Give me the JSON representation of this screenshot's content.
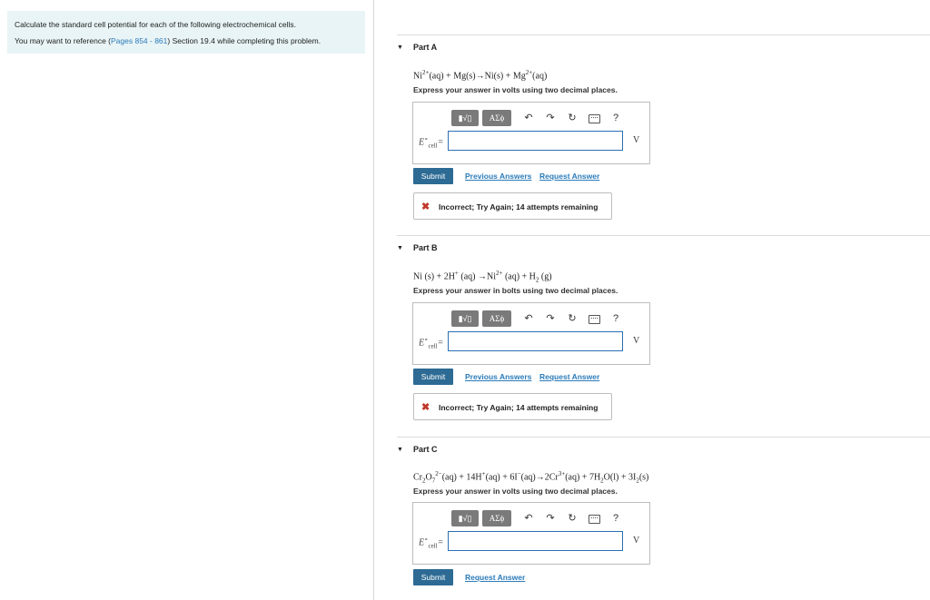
{
  "instructions": {
    "line1": "Calculate the standard cell potential for each of the following electrochemical cells.",
    "line2_prefix": "You may want to reference (",
    "line2_link": "Pages 854 - 861",
    "line2_suffix": ") Section 19.4 while completing this problem."
  },
  "toolbar": {
    "template_icon": "template-icon",
    "greek_label": "ΑΣϕ",
    "undo_icon": "↶",
    "redo_icon": "↷",
    "reset_icon": "↻",
    "help_label": "?"
  },
  "parts": [
    {
      "title": "Part A",
      "instruction": "Express your answer in volts using two decimal places.",
      "unit": "V",
      "submit": "Submit",
      "previous_answers": "Previous Answers",
      "request_answer": "Request Answer",
      "feedback": "Incorrect; Try Again; 14 attempts remaining"
    },
    {
      "title": "Part B",
      "instruction": "Express your answer in bolts using two decimal places.",
      "unit": "V",
      "submit": "Submit",
      "previous_answers": "Previous Answers",
      "request_answer": "Request Answer",
      "feedback": "Incorrect; Try Again; 14 attempts remaining"
    },
    {
      "title": "Part C",
      "instruction": "Express your answer in volts using two decimal places.",
      "unit": "V",
      "submit": "Submit",
      "request_answer": "Request Answer"
    }
  ],
  "colors": {
    "panel_bg": "#e9f4f6",
    "link": "#2b7bb9",
    "submit_bg": "#2d6b94",
    "incorrect": "#c0392b",
    "input_border": "#2a6fb5"
  }
}
